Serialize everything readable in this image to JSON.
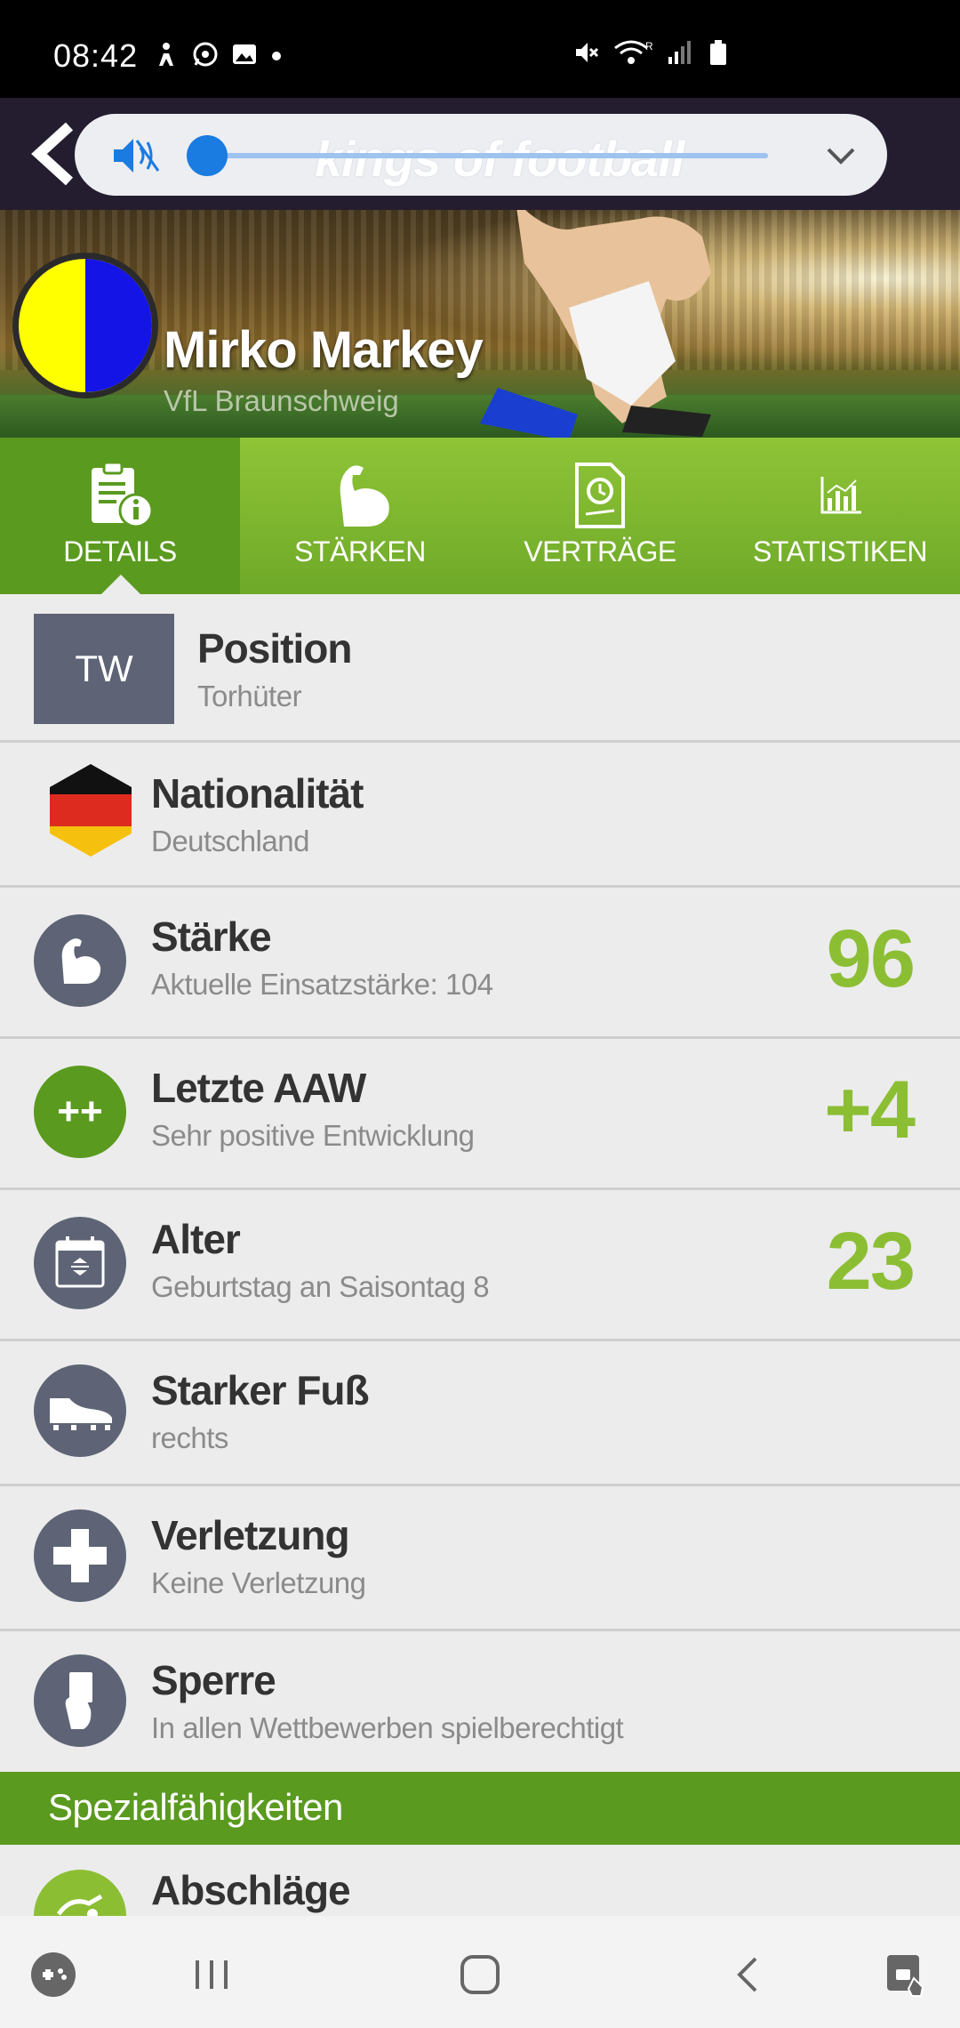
{
  "status_bar": {
    "time": "08:42",
    "left_icons": [
      "accessibility-icon",
      "whatsapp-icon",
      "image-icon",
      "dot-icon"
    ],
    "right_icons": [
      "mute-icon",
      "wifi-icon",
      "signal-icon",
      "battery-icon"
    ],
    "roaming_indicator": "R"
  },
  "topbar": {
    "logo_text": "kings of football",
    "back_icon": "chevron-left-icon",
    "mute_icon": "mute-icon",
    "dropdown_icon": "chevron-down-icon"
  },
  "hero": {
    "player_name": "Mirko Markey",
    "club_name": "VfL Braunschweig",
    "club_colors": [
      "#ffff00",
      "#1414e6"
    ]
  },
  "tabs": [
    {
      "label": "DETAILS",
      "icon": "clipboard-info-icon",
      "active": true
    },
    {
      "label": "STÄRKEN",
      "icon": "bicep-icon",
      "active": false
    },
    {
      "label": "VERTRÄGE",
      "icon": "contract-clock-icon",
      "active": false
    },
    {
      "label": "STATISTIKEN",
      "icon": "bar-chart-icon",
      "active": false
    }
  ],
  "details": {
    "position": {
      "badge": "TW",
      "title": "Position",
      "subtitle": "Torhüter"
    },
    "nationality": {
      "title": "Nationalität",
      "subtitle": "Deutschland",
      "icon": "germany-flag-icon"
    },
    "strength": {
      "title": "Stärke",
      "subtitle": "Aktuelle Einsatzstärke: 104",
      "value": "96",
      "icon": "bicep-icon"
    },
    "last_aaw": {
      "title": "Letzte AAW",
      "subtitle": "Sehr positive Entwicklung",
      "value": "+4",
      "icon_text": "++"
    },
    "age": {
      "title": "Alter",
      "subtitle": "Geburtstag an Saisontag 8",
      "value": "23",
      "icon": "calendar-icon"
    },
    "strong_foot": {
      "title": "Starker Fuß",
      "subtitle": "rechts",
      "icon": "boot-icon"
    },
    "injury": {
      "title": "Verletzung",
      "subtitle": "Keine Verletzung",
      "icon": "medical-cross-icon"
    },
    "ban": {
      "title": "Sperre",
      "subtitle": "In allen Wettbewerben spielberechtigt",
      "icon": "referee-card-icon"
    }
  },
  "special_abilities": {
    "section_title": "Spezialfähigkeiten",
    "first_item": {
      "title": "Abschläge",
      "icon": "kick-icon"
    }
  },
  "colors": {
    "accent_green": "#8cbe34",
    "tab_green": "#6ea928",
    "icon_gray": "#5e6475",
    "slider_blue": "#1a7be0"
  },
  "navbar": {
    "items": [
      "game-launcher-icon",
      "recent-apps-icon",
      "home-icon",
      "back-icon",
      "app-lock-icon"
    ]
  }
}
